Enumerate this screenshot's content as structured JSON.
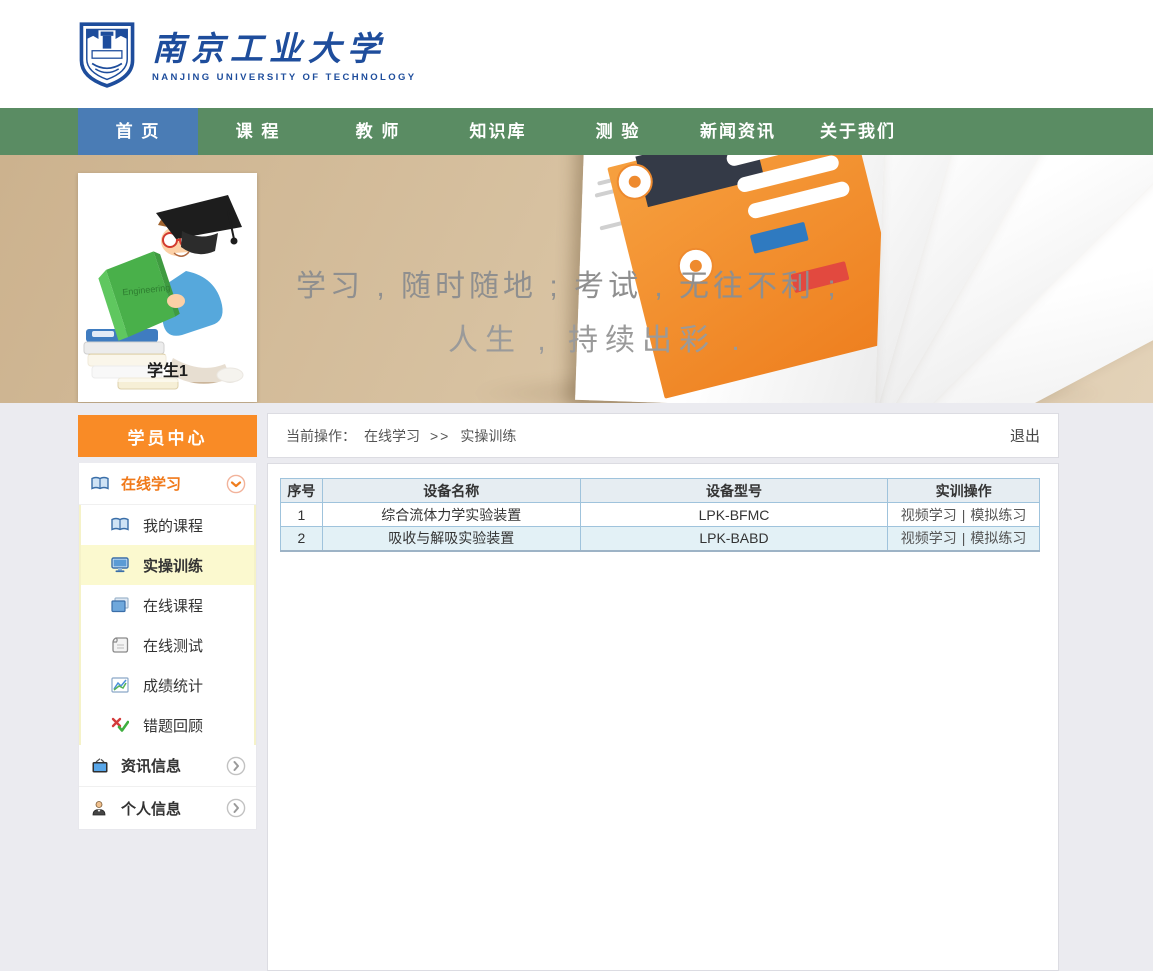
{
  "colors": {
    "nav_green": "#5a8c63",
    "active_blue": "#4a7cb5",
    "accent_orange": "#f98b26",
    "logo_blue": "#1e4d9c",
    "highlight_yellow": "#fbf9cf",
    "table_border": "#9fc3dc"
  },
  "header": {
    "university_cn": "南京工业大学",
    "university_en": "NANJING UNIVERSITY OF TECHNOLOGY"
  },
  "nav": {
    "items": [
      {
        "label": "首 页",
        "active": true
      },
      {
        "label": "课 程",
        "active": false
      },
      {
        "label": "教 师",
        "active": false
      },
      {
        "label": "知识库",
        "active": false
      },
      {
        "label": "测 验",
        "active": false
      },
      {
        "label": "新闻资讯",
        "active": false
      },
      {
        "label": "关于我们",
        "active": false
      }
    ]
  },
  "banner": {
    "slogan_line1": "学习 , 随时随地 ; 考试 , 无往不利 ;",
    "slogan_line2": "人生 , 持续出彩 .",
    "student_label": "学生1",
    "book_label": "Engineering"
  },
  "sidebar": {
    "title": "学员中心",
    "online_group": {
      "label": "在线学习"
    },
    "sub_items": [
      {
        "label": "我的课程",
        "active": false
      },
      {
        "label": "实操训练",
        "active": true
      },
      {
        "label": "在线课程",
        "active": false
      },
      {
        "label": "在线测试",
        "active": false
      },
      {
        "label": "成绩统计",
        "active": false
      },
      {
        "label": "错题回顾",
        "active": false
      }
    ],
    "groups": [
      {
        "label": "资讯信息"
      },
      {
        "label": "个人信息"
      }
    ]
  },
  "breadcrumb": {
    "prefix": "当前操作：",
    "section": "在线学习",
    "separator": ">>",
    "page": "实操训练",
    "logout": "退出"
  },
  "table": {
    "headers": [
      "序号",
      "设备名称",
      "设备型号",
      "实训操作"
    ],
    "action_separator": "|",
    "rows": [
      {
        "no": "1",
        "name": "综合流体力学实验装置",
        "model": "LPK-BFMC",
        "actions": [
          "视频学习",
          "模拟练习"
        ]
      },
      {
        "no": "2",
        "name": "吸收与解吸实验装置",
        "model": "LPK-BABD",
        "actions": [
          "视频学习",
          "模拟练习"
        ]
      }
    ]
  }
}
